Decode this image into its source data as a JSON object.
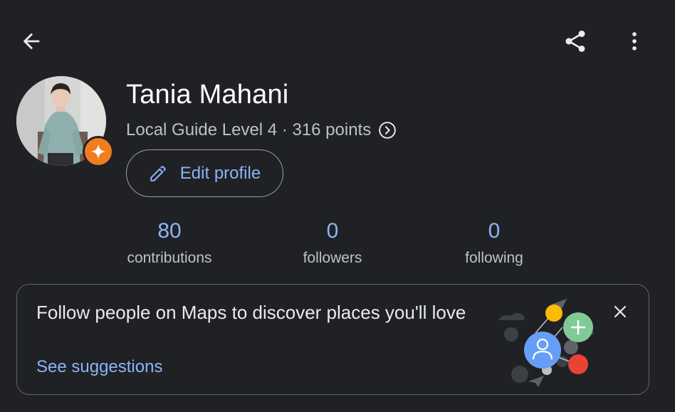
{
  "profile": {
    "name": "Tania Mahani",
    "guide_level": "Local Guide Level 4 · 316 points",
    "edit_label": "Edit profile"
  },
  "stats": [
    {
      "value": "80",
      "label": "contributions"
    },
    {
      "value": "0",
      "label": "followers"
    },
    {
      "value": "0",
      "label": "following"
    }
  ],
  "card": {
    "text": "Follow people on Maps to discover places you'll love",
    "link": "See suggestions"
  },
  "icons": {
    "back": "arrow-back-icon",
    "share": "share-icon",
    "more": "more-vert-icon",
    "badge": "local-guide-star-icon",
    "edit": "pencil-icon",
    "info": "chevron-right-circle-icon",
    "close": "close-icon"
  },
  "colors": {
    "background": "#202124",
    "accent": "#8ab4f8",
    "badge": "#f07d1e",
    "text_secondary": "#bdc1c6"
  }
}
